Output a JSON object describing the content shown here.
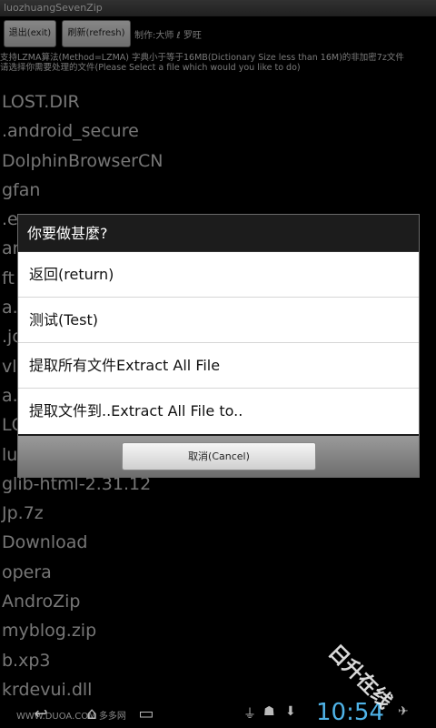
{
  "app": {
    "title": "luozhuangSevenZip"
  },
  "toolbar": {
    "exit_label": "退出(exit)",
    "refresh_label": "刷新(refresh)",
    "credit": "制作:大师 ℓ 罗旺"
  },
  "description": {
    "line1": "支持LZMA算法(Method=LZMA) 字典小于等于16MB(Dictionary Size less than 16M)的非加密7z文件",
    "line2": "请选择你需要处理的文件(Please Select a file which would you like to do)"
  },
  "files": [
    "LOST.DIR",
    ".android_secure",
    "DolphinBrowserCN",
    "gfan",
    ".e",
    "ar",
    "ft",
    "a.",
    ".jo",
    "vl",
    "a.",
    "LC",
    "lu",
    "glib-html-2.31.12",
    "Jp.7z",
    "Download",
    "opera",
    "AndroZip",
    "myblog.zip",
    "b.xp3",
    "krdevui.dll"
  ],
  "dialog": {
    "title": "你要做甚麼?",
    "options": [
      "返回(return)",
      "测试(Test)",
      "提取所有文件Extract All File",
      "提取文件到..Extract All File to.."
    ],
    "cancel_label": "取消(Cancel)"
  },
  "statusbar": {
    "time": "10:54",
    "watermark_text": "WWW.DUOA.COM 多多网",
    "icons": [
      "back-icon",
      "home-icon",
      "recent-apps-icon",
      "usb-icon",
      "android-debug-icon",
      "download-icon",
      "wifi-icon"
    ]
  },
  "watermark": "日升在线"
}
